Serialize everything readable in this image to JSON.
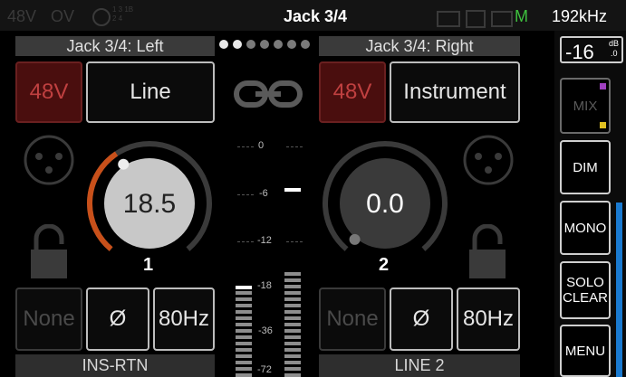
{
  "status": {
    "phantom": "48V",
    "overload": "OV",
    "sync_tiny_1": "1 3 1B",
    "sync_tiny_2": "2 4",
    "title": "Jack 3/4",
    "monitor": "M",
    "sample_rate": "192kHz"
  },
  "left": {
    "header": "Jack 3/4: Left",
    "phantom_label": "48V",
    "source_label": "Line",
    "gain_value": "18.5",
    "gain_fraction": 0.38,
    "channel_number": "1",
    "eq_label": "None",
    "phase_label": "Ø",
    "hpf_label": "80Hz",
    "bottom_label": "INS-RTN"
  },
  "right": {
    "header": "Jack 3/4: Right",
    "phantom_label": "48V",
    "source_label": "Instrument",
    "gain_value": "0.0",
    "gain_fraction": 0.0,
    "channel_number": "2",
    "eq_label": "None",
    "phase_label": "Ø",
    "hpf_label": "80Hz",
    "bottom_label": "LINE 2"
  },
  "meter": {
    "ticks": [
      "0",
      "-6",
      "-12",
      "-18",
      "-36",
      "-72"
    ]
  },
  "sidebar": {
    "level_value": "-16",
    "level_unit_top": "dB",
    "level_unit_bottom": ".0",
    "mix_label": "MIX",
    "dim_label": "DIM",
    "mono_label": "MONO",
    "solo_clear_line1": "SOLO",
    "solo_clear_line2": "CLEAR",
    "menu_label": "MENU"
  },
  "colors": {
    "knob_arc": "#c8501a",
    "mix_purple": "#a040c0",
    "mix_yellow": "#e0c020",
    "monitor_green": "#3ec03e",
    "level_blue": "#1a7ad0"
  }
}
